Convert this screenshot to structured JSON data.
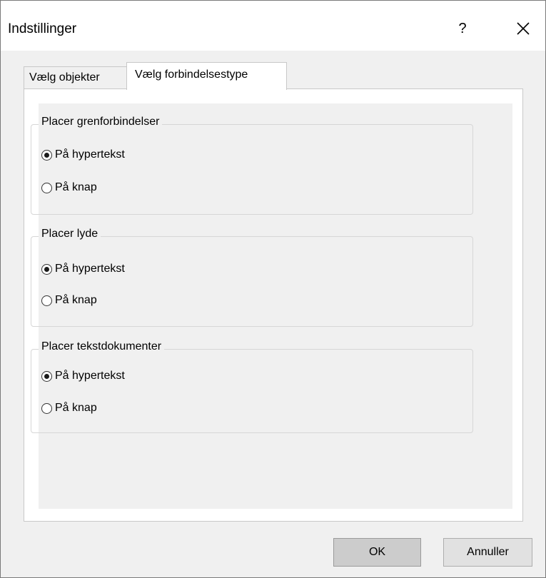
{
  "window": {
    "title": "Indstillinger",
    "help_label": "?"
  },
  "tabs": [
    {
      "label": "Vælg objekter",
      "active": false
    },
    {
      "label": "Vælg forbindelsestype",
      "active": true
    }
  ],
  "groups": [
    {
      "legend": "Placer grenforbindelser",
      "options": [
        {
          "label": "På hypertekst",
          "checked": true
        },
        {
          "label": "På knap",
          "checked": false
        }
      ]
    },
    {
      "legend": "Placer lyde",
      "options": [
        {
          "label": "På hypertekst",
          "checked": true
        },
        {
          "label": "På knap",
          "checked": false
        }
      ]
    },
    {
      "legend": "Placer tekstdokumenter",
      "options": [
        {
          "label": "På hypertekst",
          "checked": true
        },
        {
          "label": "På knap",
          "checked": false
        }
      ]
    }
  ],
  "buttons": {
    "ok": "OK",
    "cancel": "Annuller"
  }
}
